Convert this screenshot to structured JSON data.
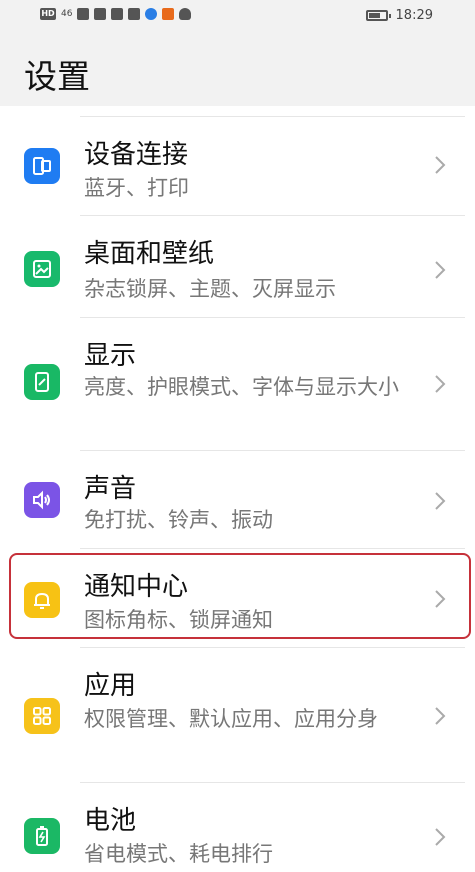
{
  "status_bar": {
    "left_icons": [
      "hd-icon",
      "signal-4g-icon",
      "wifi-icon",
      "hourglass-icon",
      "message-icon",
      "app-icon-blue",
      "app-icon-orange",
      "cloud-icon"
    ],
    "hd_text": "HD",
    "network_text": "46",
    "time": "18:29"
  },
  "page": {
    "title": "设置"
  },
  "settings": {
    "items": [
      {
        "title": "设备连接",
        "subtitle": "蓝牙、打印",
        "icon": "device-connection-icon",
        "color": "#1f7cf2"
      },
      {
        "title": "桌面和壁纸",
        "subtitle": "杂志锁屏、主题、灭屏显示",
        "icon": "wallpaper-icon",
        "color": "#18b96c"
      },
      {
        "title": "显示",
        "subtitle": "亮度、护眼模式、字体与显示大小",
        "icon": "display-icon",
        "color": "#19b865"
      },
      {
        "title": "声音",
        "subtitle": "免打扰、铃声、振动",
        "icon": "sound-icon",
        "color": "#7b54e6"
      },
      {
        "title": "通知中心",
        "subtitle": "图标角标、锁屏通知",
        "icon": "bell-icon",
        "color": "#f7c214"
      },
      {
        "title": "应用",
        "subtitle": "权限管理、默认应用、应用分身",
        "icon": "apps-icon",
        "color": "#f6c21a"
      },
      {
        "title": "电池",
        "subtitle": "省电模式、耗电排行",
        "icon": "battery-icon",
        "color": "#1bb865"
      }
    ]
  },
  "accent": {
    "highlight": "#c6313a"
  }
}
